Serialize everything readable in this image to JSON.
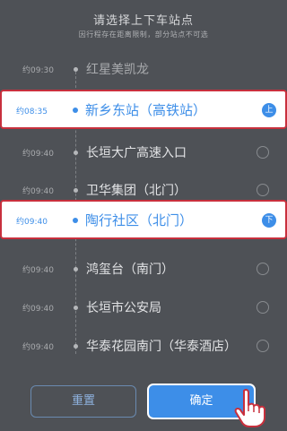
{
  "header": {
    "title": "请选择上下车站点",
    "subtitle": "因行程存在距离限制，部分站点不可选"
  },
  "stops": [
    {
      "time": "约09:30",
      "name": "红星美凯龙",
      "state": "dim"
    },
    {
      "time": "约08:35",
      "name": "新乡东站（高铁站）",
      "state": "board",
      "badge": "上"
    },
    {
      "time": "约09:40",
      "name": "长垣大广高速入口",
      "state": "normal"
    },
    {
      "time": "约09:40",
      "name": "卫华集团（北门）",
      "state": "normal"
    },
    {
      "time": "约09:40",
      "name": "陶行社区（北门）",
      "state": "alight",
      "badge": "下"
    },
    {
      "time": "约09:40",
      "name": "鸿玺台（南门）",
      "state": "normal"
    },
    {
      "time": "约09:40",
      "name": "长垣市公安局",
      "state": "normal"
    },
    {
      "time": "约09:40",
      "name": "华泰花园南门（华泰酒店）",
      "state": "normal"
    }
  ],
  "footer": {
    "reset_label": "重置",
    "confirm_label": "确定"
  },
  "colors": {
    "accent": "#3d8ee8",
    "highlight_border": "#c8303d",
    "overlay": "#4e5156"
  },
  "icons": {
    "pointer": "hand-pointer-icon"
  }
}
